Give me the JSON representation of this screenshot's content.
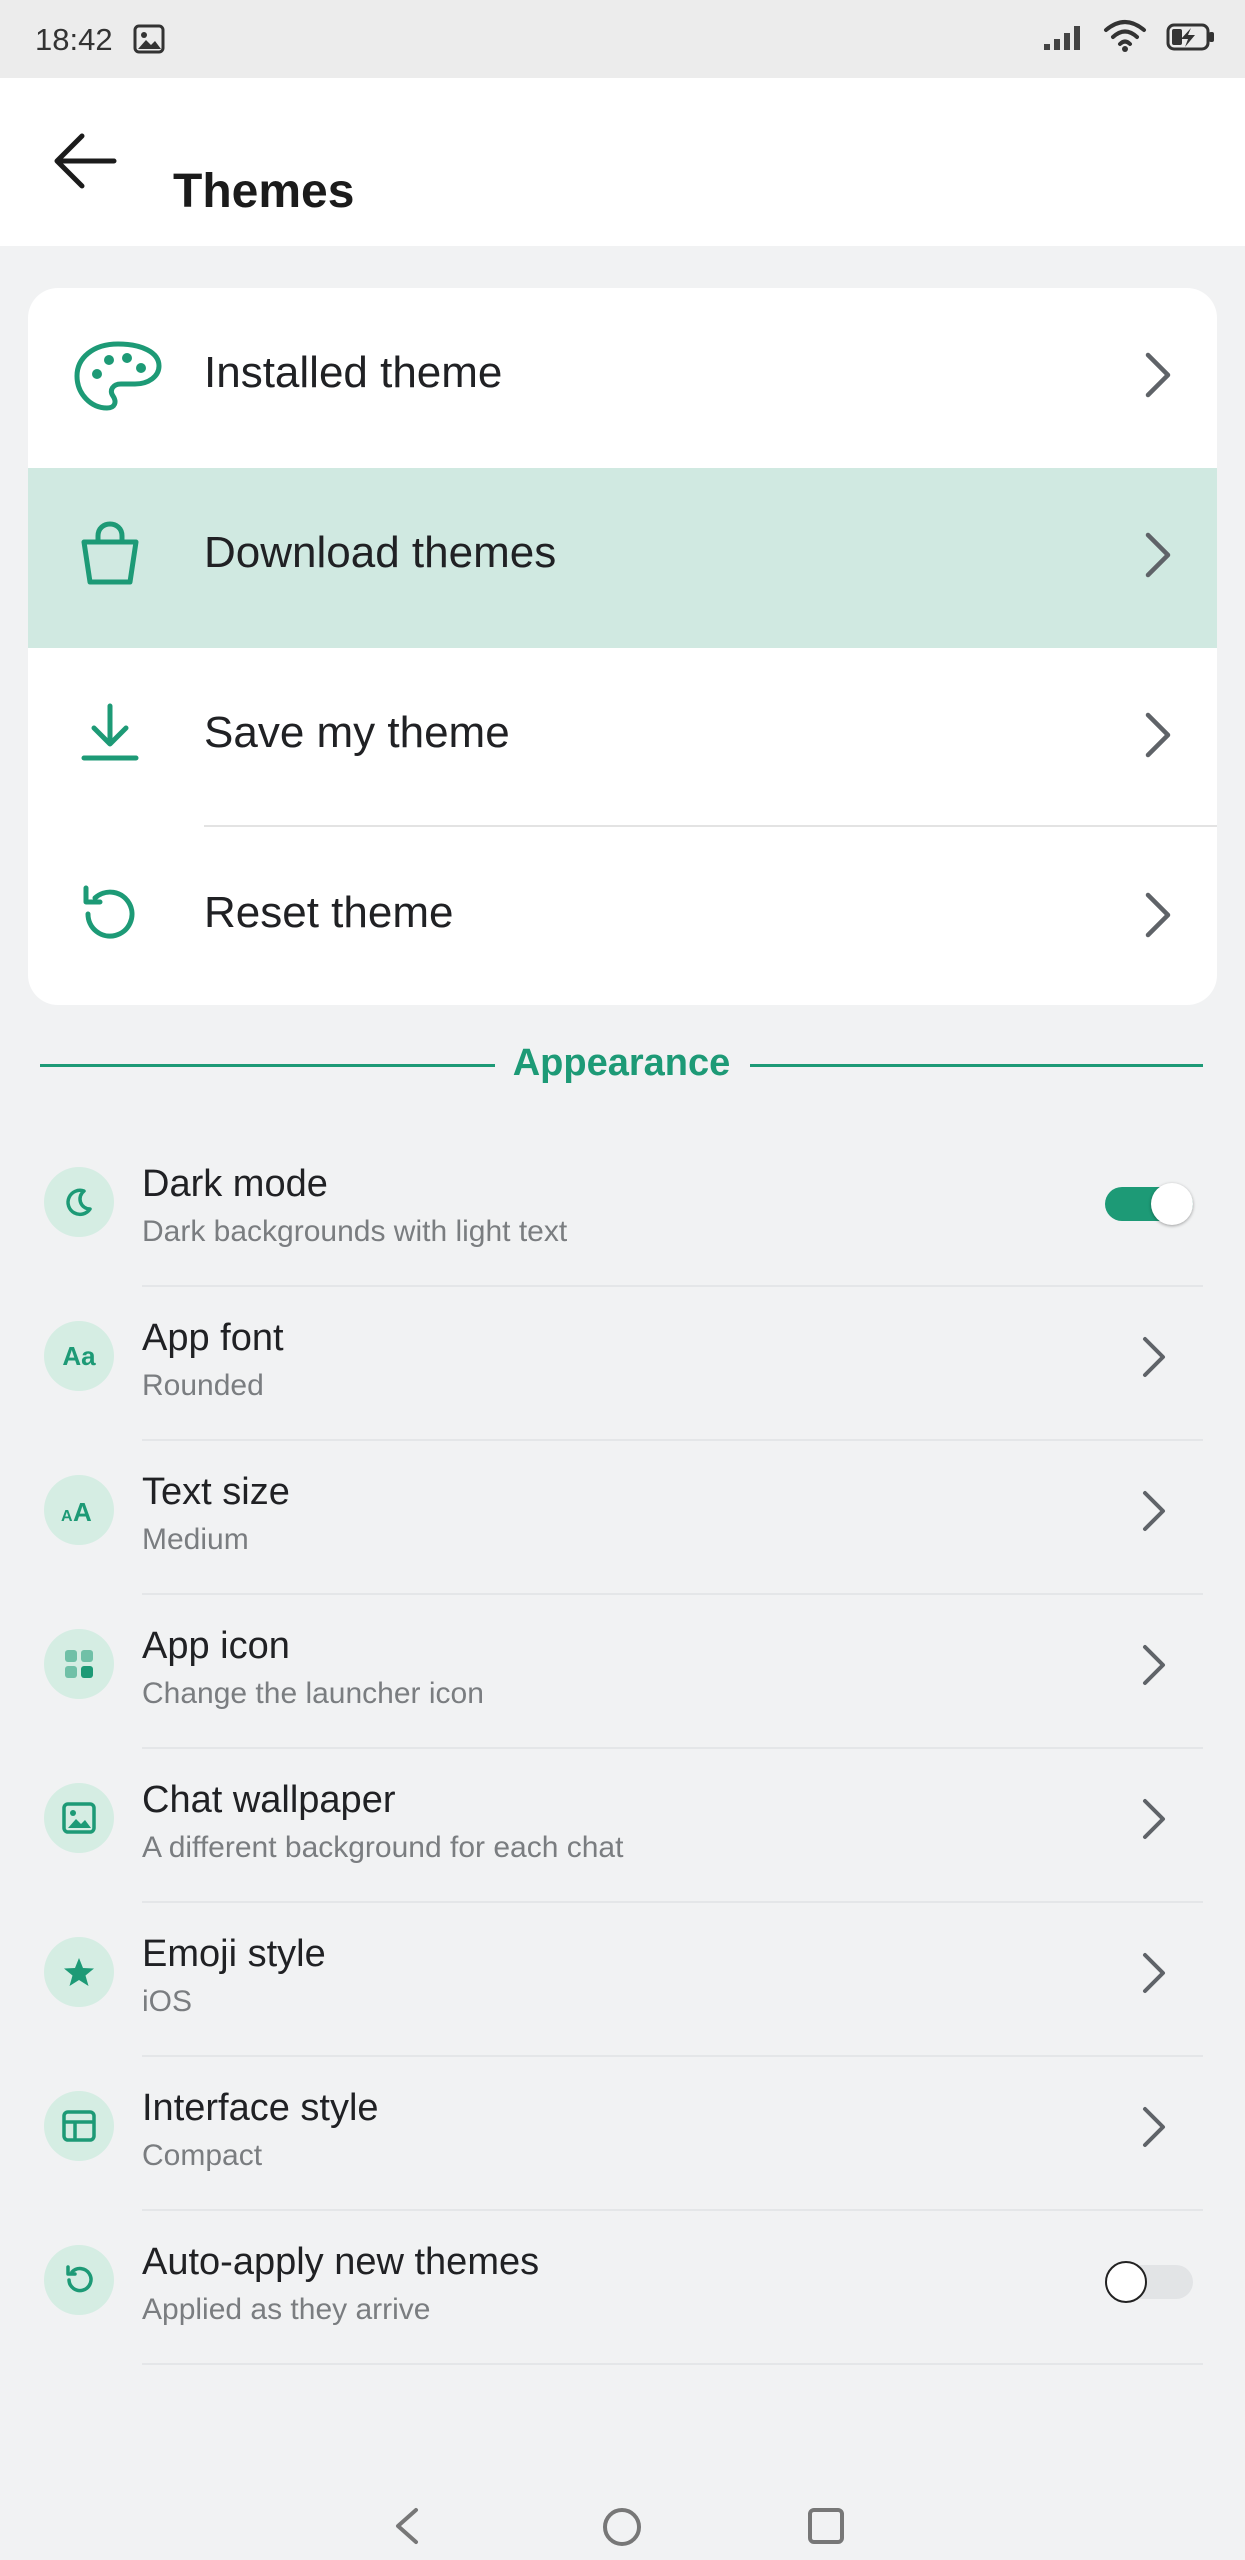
{
  "status_bar": {
    "time": "18:42",
    "icons": [
      "gallery-icon",
      "signal-icon",
      "wifi-icon",
      "battery-charging-icon"
    ]
  },
  "header": {
    "title": "Themes",
    "back_icon": "arrow-left-icon"
  },
  "theme_menu": [
    {
      "label": "Installed theme",
      "icon": "palette-icon",
      "selected": false
    },
    {
      "label": "Download themes",
      "icon": "shopping-bag-icon",
      "selected": true
    },
    {
      "label": "Save my theme",
      "icon": "download-icon",
      "selected": false
    },
    {
      "label": "Reset theme",
      "icon": "reset-icon",
      "selected": false
    }
  ],
  "appearance": {
    "section_label": "Appearance",
    "items": [
      {
        "title": "Dark mode",
        "subtitle": "Dark backgrounds with light text",
        "icon": "moon-icon",
        "control": "toggle",
        "on": true
      },
      {
        "title": "App font",
        "subtitle": "Rounded",
        "icon": "font-icon",
        "icon_text": "Aa",
        "control": "chevron"
      },
      {
        "title": "Text size",
        "subtitle": "Medium",
        "icon": "text-size-icon",
        "icon_text": "AA",
        "control": "chevron"
      },
      {
        "title": "App icon",
        "subtitle": "Change the launcher icon",
        "icon": "grid-icon",
        "control": "chevron"
      },
      {
        "title": "Chat wallpaper",
        "subtitle": "A different background for each chat",
        "icon": "image-icon",
        "control": "chevron"
      },
      {
        "title": "Emoji style",
        "subtitle": "iOS",
        "icon": "star-icon",
        "control": "chevron"
      },
      {
        "title": "Interface style",
        "subtitle": "Compact",
        "icon": "layout-icon",
        "control": "chevron"
      },
      {
        "title": "Auto-apply new themes",
        "subtitle": "Applied as they arrive",
        "icon": "refresh-icon",
        "control": "toggle",
        "on": false
      }
    ]
  },
  "nav_bar": {
    "buttons": [
      "back-nav-icon",
      "home-nav-icon",
      "recents-nav-icon"
    ]
  },
  "colors": {
    "accent": "#1d9a76",
    "selected_row": "#d0e9e1",
    "icon_bubble": "#d5ede3",
    "background": "#f1f2f3"
  }
}
